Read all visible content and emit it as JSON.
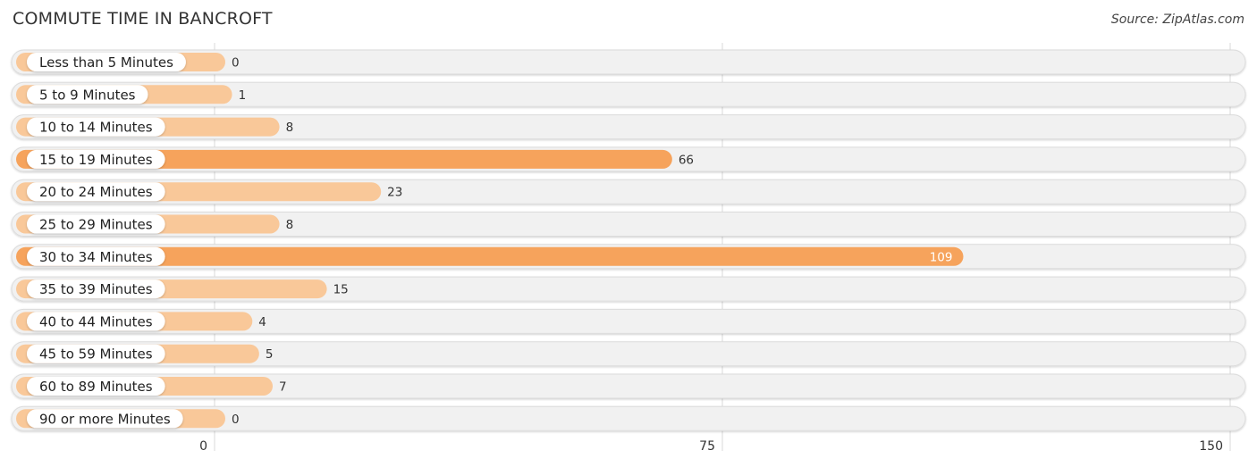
{
  "header": {
    "title": "COMMUTE TIME IN BANCROFT",
    "source": "Source: ZipAtlas.com"
  },
  "colors": {
    "bar_light": "#f9c899",
    "bar_strong": "#f6a35c",
    "track": "#f1f1f1",
    "grid": "#d8d8d8"
  },
  "chart_data": {
    "type": "bar",
    "orientation": "horizontal",
    "title": "COMMUTE TIME IN BANCROFT",
    "categories": [
      "Less than 5 Minutes",
      "5 to 9 Minutes",
      "10 to 14 Minutes",
      "15 to 19 Minutes",
      "20 to 24 Minutes",
      "25 to 29 Minutes",
      "30 to 34 Minutes",
      "35 to 39 Minutes",
      "40 to 44 Minutes",
      "45 to 59 Minutes",
      "60 to 89 Minutes",
      "90 or more Minutes"
    ],
    "values": [
      0,
      1,
      8,
      66,
      23,
      8,
      109,
      15,
      4,
      5,
      7,
      0
    ],
    "xlabel": "",
    "ylabel": "",
    "xlim": [
      0,
      150
    ],
    "xticks": [
      0,
      75,
      150
    ],
    "grid": true,
    "legend": "none"
  }
}
